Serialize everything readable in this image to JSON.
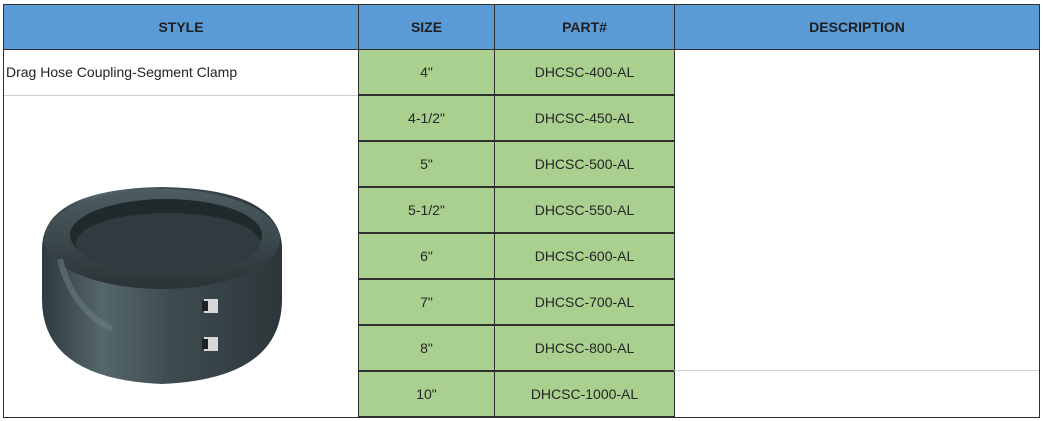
{
  "headers": {
    "style": "STYLE",
    "size": "SIZE",
    "part": "PART#",
    "description": "DESCRIPTION"
  },
  "style_text": "Drag Hose Coupling-Segment Clamp",
  "rows": [
    {
      "size": "4\"",
      "part": "DHCSC-400-AL"
    },
    {
      "size": "4-1/2\"",
      "part": "DHCSC-450-AL"
    },
    {
      "size": "5\"",
      "part": "DHCSC-500-AL"
    },
    {
      "size": "5-1/2\"",
      "part": "DHCSC-550-AL"
    },
    {
      "size": "6\"",
      "part": "DHCSC-600-AL"
    },
    {
      "size": "7\"",
      "part": "DHCSC-700-AL"
    },
    {
      "size": "8\"",
      "part": "DHCSC-800-AL"
    },
    {
      "size": "10\"",
      "part": "DHCSC-1000-AL"
    }
  ],
  "colors": {
    "header_bg": "#5b9bd5",
    "cell_bg": "#a9d08e"
  },
  "image": "segment-clamp-photo"
}
